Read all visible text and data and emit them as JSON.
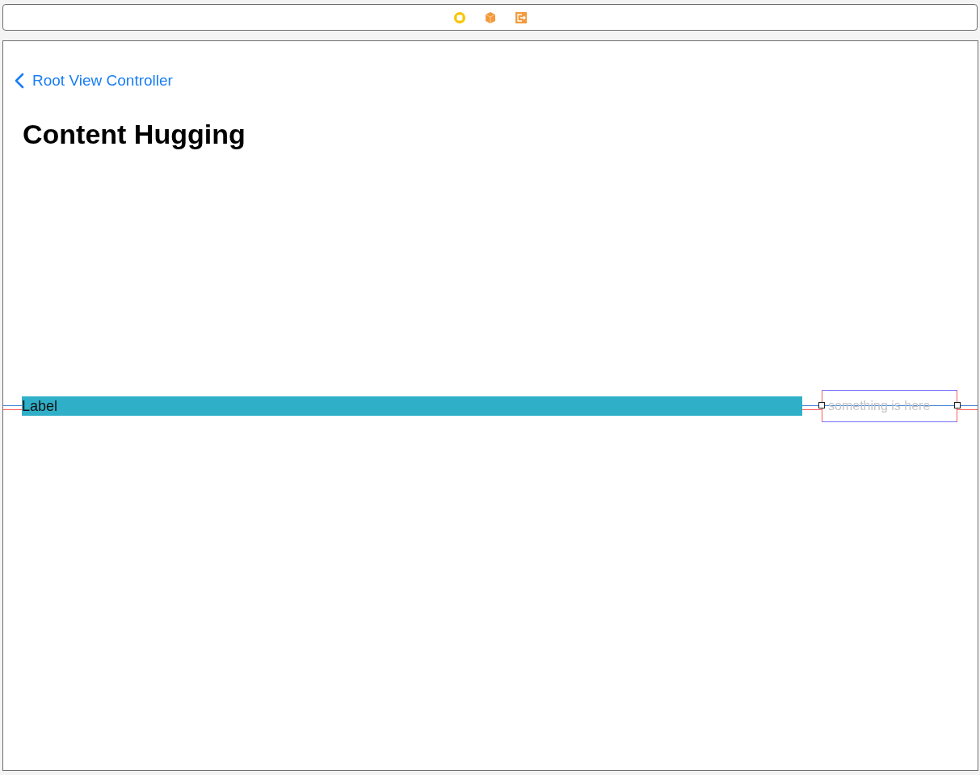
{
  "scene": {
    "back_label": "Root View Controller",
    "title": "Content Hugging",
    "label": {
      "text": "Label"
    },
    "text_field": {
      "placeholder": "something is here"
    }
  }
}
